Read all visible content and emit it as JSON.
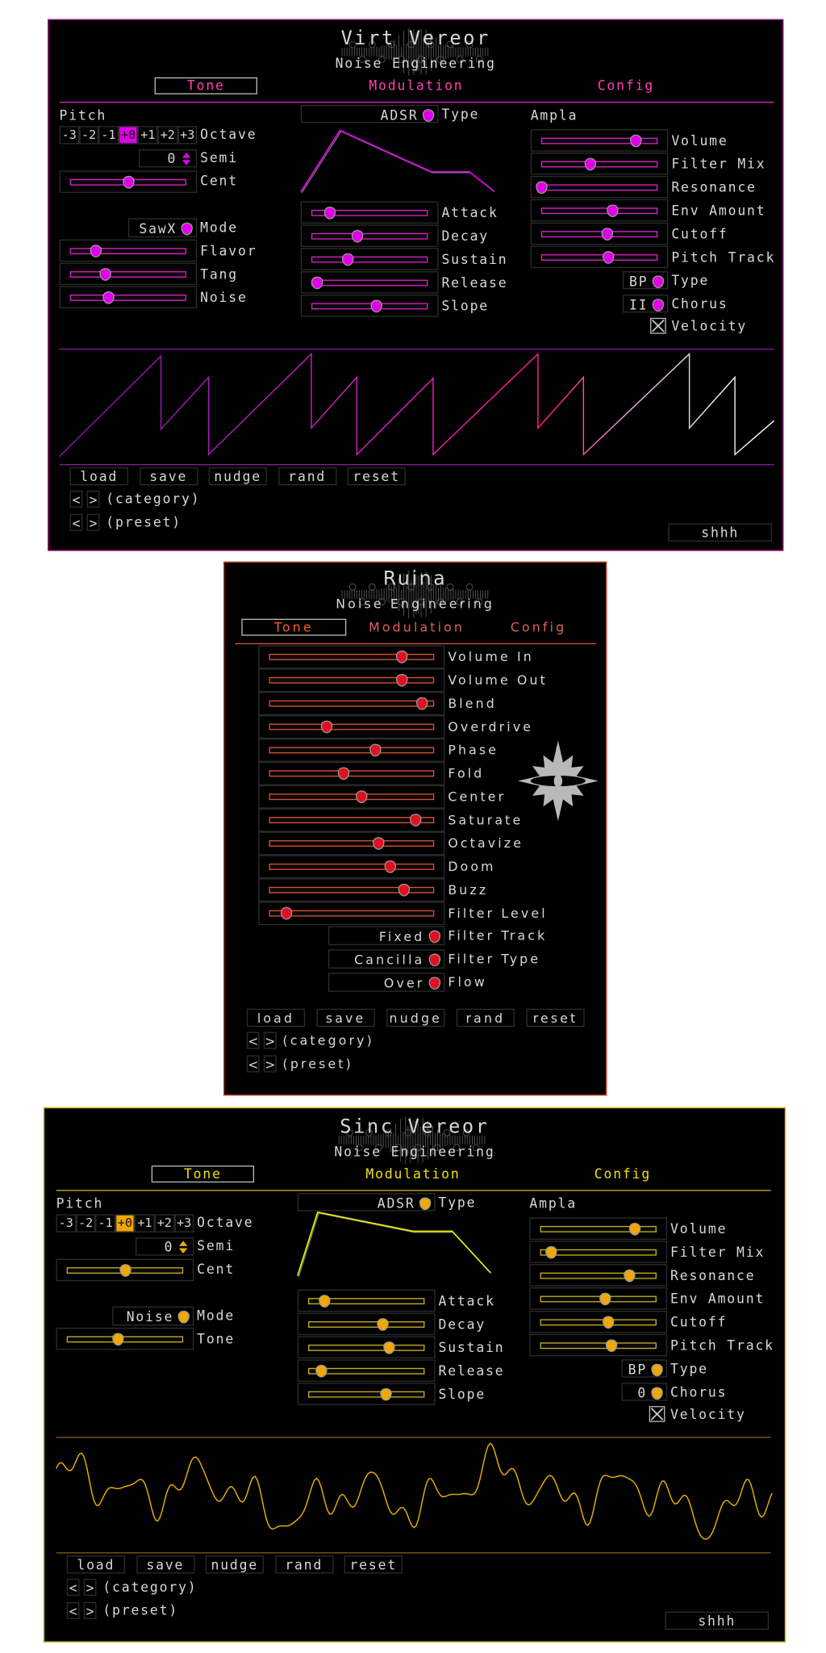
{
  "panels": [
    {
      "title": "Virt Vereor",
      "brand": "Noise Engineering",
      "tabs": [
        "Tone",
        "Modulation",
        "Config"
      ],
      "active_tab": "Tone",
      "colors": {
        "border": "#b0188c",
        "accent": "#e020c8",
        "tab": "#ff3fb0",
        "thumb": "#e000e8",
        "line": "#8a1aa0"
      },
      "pitch": {
        "label": "Pitch",
        "octave_options": [
          "-3",
          "-2",
          "-1",
          "+0",
          "+1",
          "+2",
          "+3"
        ],
        "octave_selected": "+0",
        "octave_label": "Octave",
        "semi_value": "0",
        "semi_label": "Semi",
        "cent_label": "Cent",
        "cent_value": 0.5,
        "mode_value": "SawX",
        "mode_label": "Mode"
      },
      "tone_sliders": [
        {
          "label": "Flavor",
          "value": 0.22
        },
        {
          "label": "Tang",
          "value": 0.3
        },
        {
          "label": "Noise",
          "value": 0.33
        }
      ],
      "envelope": {
        "type_value": "ADSR",
        "type_label": "Type",
        "sliders": [
          {
            "label": "Attack",
            "value": 0.16
          },
          {
            "label": "Decay",
            "value": 0.39
          },
          {
            "label": "Sustain",
            "value": 0.31
          },
          {
            "label": "Release",
            "value": 0.05
          },
          {
            "label": "Slope",
            "value": 0.55
          }
        ]
      },
      "ampla": {
        "label": "Ampla",
        "sliders": [
          {
            "label": "Volume",
            "value": 0.8
          },
          {
            "label": "Filter Mix",
            "value": 0.42
          },
          {
            "label": "Resonance",
            "value": 0.01
          },
          {
            "label": "Env Amount",
            "value": 0.61
          },
          {
            "label": "Cutoff",
            "value": 0.56
          },
          {
            "label": "Pitch Track",
            "value": 0.57
          }
        ],
        "type_value": "BP",
        "type_label": "Type",
        "chorus_value": "II",
        "chorus_label": "Chorus",
        "velocity_label": "Velocity",
        "velocity_checked": true
      },
      "footer": {
        "buttons": [
          "load",
          "save",
          "nudge",
          "rand",
          "reset"
        ],
        "prev": "<",
        "next": ">",
        "category_label": "(category)",
        "preset_label": "(preset)",
        "shhh": "shhh"
      }
    },
    {
      "title": "Ruina",
      "brand": "Noise Engineering",
      "tabs": [
        "Tone",
        "Modulation",
        "Config"
      ],
      "active_tab": "Tone",
      "colors": {
        "border": "#c84020",
        "accent": "#e05030",
        "tab": "#ff5a28",
        "tab2": "#e06060",
        "thumb": "#e01020",
        "line": "#c84020",
        "logo": "#b8b8b8"
      },
      "sliders": [
        {
          "label": "Volume In",
          "value": 0.8
        },
        {
          "label": "Volume Out",
          "value": 0.8
        },
        {
          "label": "Blend",
          "value": 0.92
        },
        {
          "label": "Overdrive",
          "value": 0.35
        },
        {
          "label": "Phase",
          "value": 0.64
        },
        {
          "label": "Fold",
          "value": 0.45
        },
        {
          "label": "Center",
          "value": 0.56
        },
        {
          "label": "Saturate",
          "value": 0.88
        },
        {
          "label": "Octavize",
          "value": 0.66
        },
        {
          "label": "Doom",
          "value": 0.73
        },
        {
          "label": "Buzz",
          "value": 0.81
        },
        {
          "label": "Filter Level",
          "value": 0.11
        }
      ],
      "selects": [
        {
          "value": "Fixed",
          "label": "Filter Track"
        },
        {
          "value": "Cancilla",
          "label": "Filter Type"
        },
        {
          "value": "Over",
          "label": "Flow"
        }
      ],
      "footer": {
        "buttons": [
          "load",
          "save",
          "nudge",
          "rand",
          "reset"
        ],
        "prev": "<",
        "next": ">",
        "category_label": "(category)",
        "preset_label": "(preset)"
      }
    },
    {
      "title": "Sinc Vereor",
      "brand": "Noise Engineering",
      "tabs": [
        "Tone",
        "Modulation",
        "Config"
      ],
      "active_tab": "Tone",
      "colors": {
        "border": "#d8c800",
        "accent": "#c8b020",
        "tab": "#f0e000",
        "thumb": "#f0a800",
        "line": "#8a5a10"
      },
      "pitch": {
        "label": "Pitch",
        "octave_options": [
          "-3",
          "-2",
          "-1",
          "+0",
          "+1",
          "+2",
          "+3"
        ],
        "octave_selected": "+0",
        "octave_label": "Octave",
        "semi_value": "0",
        "semi_label": "Semi",
        "cent_label": "Cent",
        "cent_value": 0.5,
        "mode_value": "Noise",
        "mode_label": "Mode"
      },
      "tone_sliders": [
        {
          "label": "Tone",
          "value": 0.44
        }
      ],
      "envelope": {
        "type_value": "ADSR",
        "type_label": "Type",
        "sliders": [
          {
            "label": "Attack",
            "value": 0.14
          },
          {
            "label": "Decay",
            "value": 0.63
          },
          {
            "label": "Sustain",
            "value": 0.69
          },
          {
            "label": "Release",
            "value": 0.12
          },
          {
            "label": "Slope",
            "value": 0.66
          }
        ]
      },
      "ampla": {
        "label": "Ampla",
        "sliders": [
          {
            "label": "Volume",
            "value": 0.8
          },
          {
            "label": "Filter Mix",
            "value": 0.1
          },
          {
            "label": "Resonance",
            "value": 0.76
          },
          {
            "label": "Env Amount",
            "value": 0.55
          },
          {
            "label": "Cutoff",
            "value": 0.58
          },
          {
            "label": "Pitch Track",
            "value": 0.61
          }
        ],
        "type_value": "BP",
        "type_label": "Type",
        "chorus_value": "0",
        "chorus_label": "Chorus",
        "velocity_label": "Velocity",
        "velocity_checked": true
      },
      "footer": {
        "buttons": [
          "load",
          "save",
          "nudge",
          "rand",
          "reset"
        ],
        "prev": "<",
        "next": ">",
        "category_label": "(category)",
        "preset_label": "(preset)",
        "shhh": "shhh"
      }
    }
  ]
}
